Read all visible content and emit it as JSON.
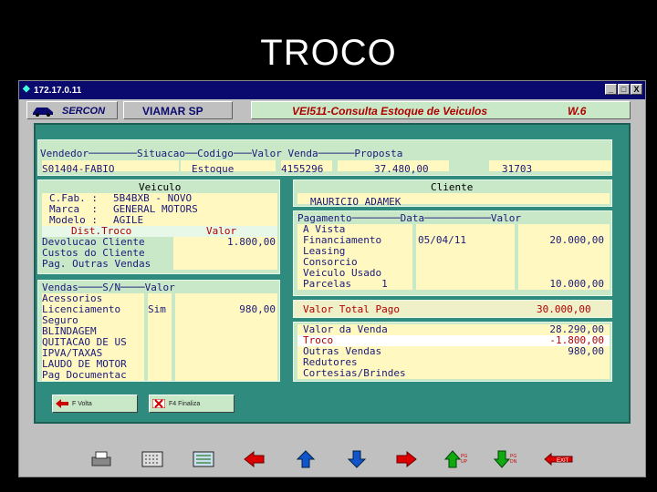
{
  "slide": {
    "title": "TROCO"
  },
  "window": {
    "title": "172.17.0.11",
    "min": "_",
    "max": "□",
    "close": "X"
  },
  "header": {
    "logo": "SERCON",
    "store": "VIAMAR SP",
    "screen": "VEI511-Consulta Estoque de Veiculos",
    "version": "W.6"
  },
  "top": {
    "headers": "Vendedor────────Situacao──Codigo───Valor Venda──────Proposta",
    "vendedor": "S01404-FABIO",
    "situacao": "Estoque",
    "codigo": "4155296",
    "valor_venda": "37.480,00",
    "proposta": "31703"
  },
  "veiculo": {
    "header": "Veiculo",
    "cfab_label": "C.Fab. :",
    "cfab": "5B4BXB - NOVO",
    "marca_label": "Marca  :",
    "marca": "GENERAL MOTORS",
    "modelo_label": "Modelo :",
    "modelo": "AGILE",
    "col_dist": "Dist.Troco",
    "col_valor": "Valor",
    "rows": [
      {
        "label": "Devolucao Cliente",
        "valor": "1.800,00"
      },
      {
        "label": "Custos do Cliente",
        "valor": ""
      },
      {
        "label": "Pag. Outras Vendas",
        "valor": ""
      }
    ]
  },
  "cliente": {
    "header": "Cliente",
    "nome": "MAURICIO ADAMEK"
  },
  "pagamento": {
    "headers": "Pagamento────────Data───────────Valor",
    "rows": [
      {
        "label": "A Vista",
        "data": "",
        "valor": ""
      },
      {
        "label": "Financiamento",
        "data": "05/04/11",
        "valor": "20.000,00"
      },
      {
        "label": "Leasing",
        "data": "",
        "valor": ""
      },
      {
        "label": "Consorcio",
        "data": "",
        "valor": ""
      },
      {
        "label": "Veiculo Usado",
        "data": "",
        "valor": ""
      },
      {
        "label": "Parcelas     1",
        "data": "",
        "valor": "10.000,00"
      }
    ]
  },
  "vendas": {
    "headers": "Vendas────S/N────Valor",
    "rows": [
      {
        "label": "Acessorios",
        "sn": "",
        "valor": ""
      },
      {
        "label": "Licenciamento",
        "sn": "Sim",
        "valor": "980,00"
      },
      {
        "label": "Seguro",
        "sn": "",
        "valor": ""
      },
      {
        "label": "BLINDAGEM",
        "sn": "",
        "valor": ""
      },
      {
        "label": "QUITACAO DE US",
        "sn": "",
        "valor": ""
      },
      {
        "label": "IPVA/TAXAS",
        "sn": "",
        "valor": ""
      },
      {
        "label": "LAUDO DE MOTOR",
        "sn": "",
        "valor": ""
      },
      {
        "label": "Pag Documentac",
        "sn": "",
        "valor": ""
      }
    ]
  },
  "total": {
    "label": "Valor Total Pago",
    "valor": "30.000,00"
  },
  "resumo": {
    "rows": [
      {
        "label": "Valor da Venda",
        "valor": "28.290,00"
      },
      {
        "label": "Troco",
        "valor": "-1.800,00"
      },
      {
        "label": "Outras Vendas",
        "valor": "980,00"
      },
      {
        "label": "Redutores",
        "valor": ""
      },
      {
        "label": "Cortesias/Brindes",
        "valor": ""
      }
    ]
  },
  "buttons": {
    "volta": "F Volta",
    "finaliza": "F4 Finaliza"
  },
  "toolbar": {
    "pgup": "PG UP",
    "pgdn": "PG DN",
    "exit": "EXIT"
  },
  "colors": {
    "accent": "#0a0a6e",
    "panel": "#2e8b7e",
    "red_text": "#b00000"
  }
}
